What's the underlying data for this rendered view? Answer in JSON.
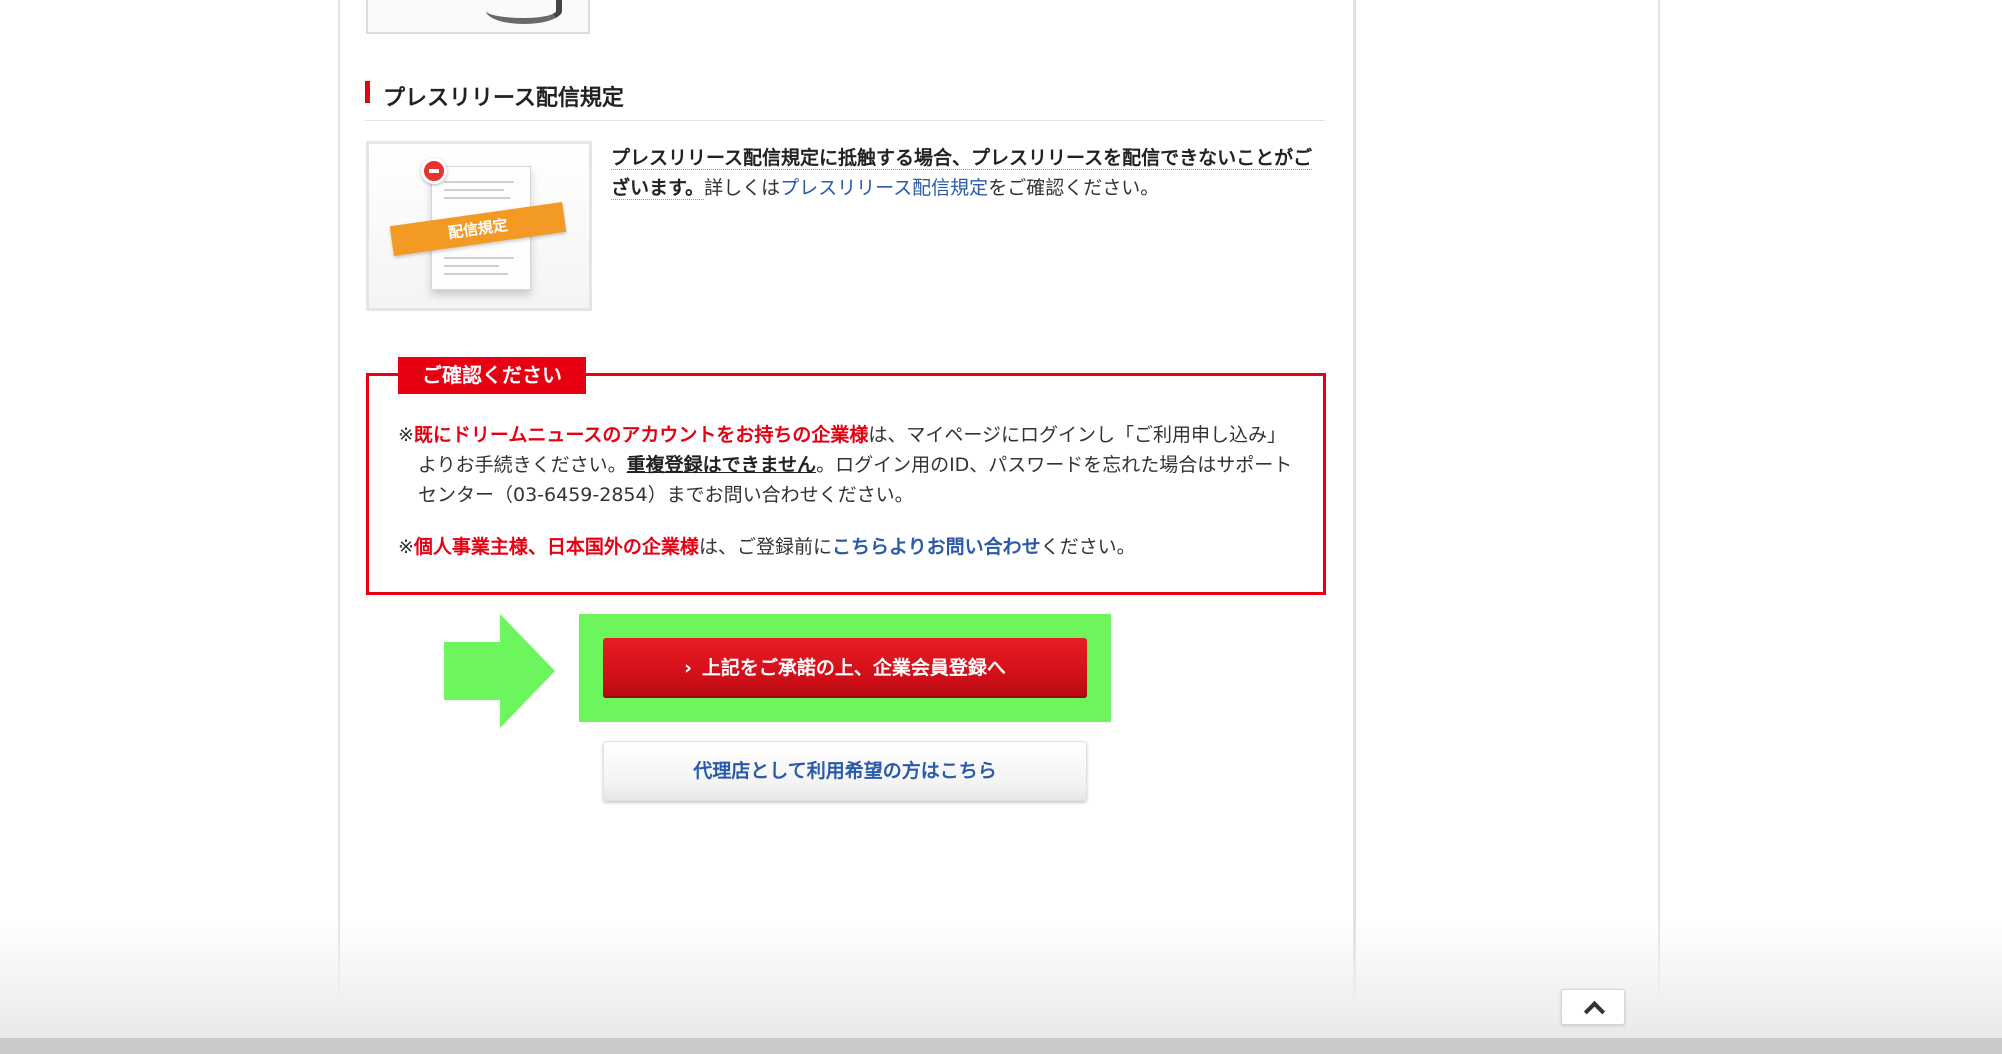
{
  "page": {
    "top_thumbnail_alt": ""
  },
  "policy_section": {
    "heading": "プレスリリース配信規定",
    "image_tag": "配信規定",
    "text_bold": "プレスリリース配信規定に抵触する場合、プレスリリースを配信できないことがございます。",
    "text_pre_link": "詳しくは",
    "link_text": "プレスリリース配信規定",
    "text_post_link": "をご確認ください。"
  },
  "notice": {
    "label": "ご確認ください",
    "item1": {
      "mark": "※",
      "red_text": "既にドリームニュースのアカウントをお持ちの企業様",
      "text_a": "は、マイページにログインし「ご利用申し込み」よりお手続きください。",
      "underline_text": "重複登録はできません",
      "text_b": "。ログイン用のID、パスワードを忘れた場合はサポートセンター（03-6459-2854）までお問い合わせください。"
    },
    "item2": {
      "mark": "※",
      "red_text": "個人事業主様、日本国外の企業様",
      "text_a": "は、ご登録前に",
      "link_text": "こちらよりお問い合わせ",
      "text_b": "ください。"
    }
  },
  "buttons": {
    "register_chevron": "›",
    "register_label": "上記をご承諾の上、企業会員登録へ",
    "agency_label": "代理店として利用希望の方はこちら"
  },
  "colors": {
    "accent_red": "#e60012",
    "link_blue": "#2a5aa8",
    "highlight_green": "#6cf55d"
  },
  "icons": {
    "page_top": "chevron-up-icon",
    "policy_minus": "minus-icon"
  }
}
